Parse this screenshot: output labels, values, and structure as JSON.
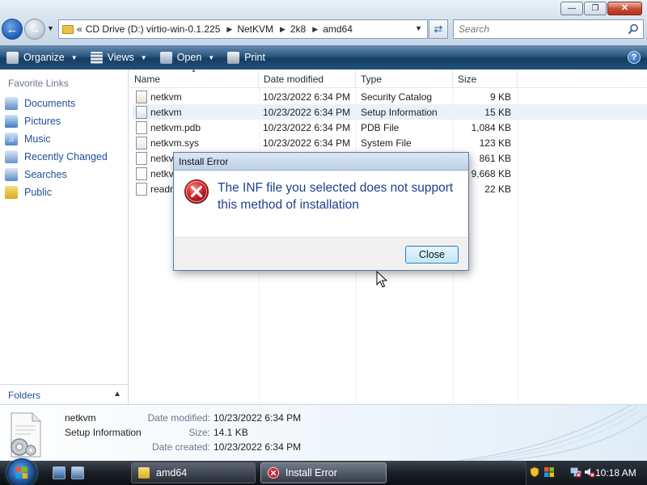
{
  "window": {
    "title_buttons": [
      "minimize",
      "maximize",
      "close"
    ]
  },
  "address": {
    "overflow": "«",
    "crumbs": [
      "CD Drive (D:) virtio-win-0.1.225",
      "NetKVM",
      "2k8",
      "amd64"
    ]
  },
  "search": {
    "placeholder": "Search"
  },
  "toolbar": {
    "organize": "Organize",
    "views": "Views",
    "open": "Open",
    "print": "Print",
    "help": "?"
  },
  "nav": {
    "title": "Favorite Links",
    "items": [
      {
        "label": "Documents",
        "icon": "documents-icon"
      },
      {
        "label": "Pictures",
        "icon": "pictures-icon"
      },
      {
        "label": "Music",
        "icon": "music-icon"
      },
      {
        "label": "Recently Changed",
        "icon": "recently-changed-icon"
      },
      {
        "label": "Searches",
        "icon": "searches-icon"
      },
      {
        "label": "Public",
        "icon": "public-folder-icon"
      }
    ],
    "folders_label": "Folders"
  },
  "columns": [
    "Name",
    "Date modified",
    "Type",
    "Size"
  ],
  "files": [
    {
      "name": "netkvm",
      "date": "10/23/2022 6:34 PM",
      "type": "Security Catalog",
      "size": "9 KB"
    },
    {
      "name": "netkvm",
      "date": "10/23/2022 6:34 PM",
      "type": "Setup Information",
      "size": "15 KB"
    },
    {
      "name": "netkvm.pdb",
      "date": "10/23/2022 6:34 PM",
      "type": "PDB File",
      "size": "1,084 KB"
    },
    {
      "name": "netkvm.sys",
      "date": "10/23/2022 6:34 PM",
      "type": "System File",
      "size": "123 KB"
    },
    {
      "name": "netkv",
      "date": "",
      "type": "",
      "size": "861 KB"
    },
    {
      "name": "netkv",
      "date": "",
      "type": "",
      "size": "9,668 KB"
    },
    {
      "name": "readr",
      "date": "",
      "type": "",
      "size": "22 KB"
    }
  ],
  "dialog": {
    "title": "Install Error",
    "message": "The INF file you selected does not support this method of installation",
    "close_label": "Close"
  },
  "details": {
    "name": "netkvm",
    "type": "Setup Information",
    "date_modified_label": "Date modified:",
    "date_modified": "10/23/2022 6:34 PM",
    "size_label": "Size:",
    "size": "14.1 KB",
    "date_created_label": "Date created:",
    "date_created": "10/23/2022 6:34 PM"
  },
  "taskbar": {
    "tasks": [
      {
        "label": "amd64"
      },
      {
        "label": "Install Error"
      }
    ],
    "clock": "10:18 AM"
  },
  "colors": {
    "link_blue": "#1f4f9a",
    "error_red": "#c8202a",
    "selection": "#eaf1fa"
  }
}
